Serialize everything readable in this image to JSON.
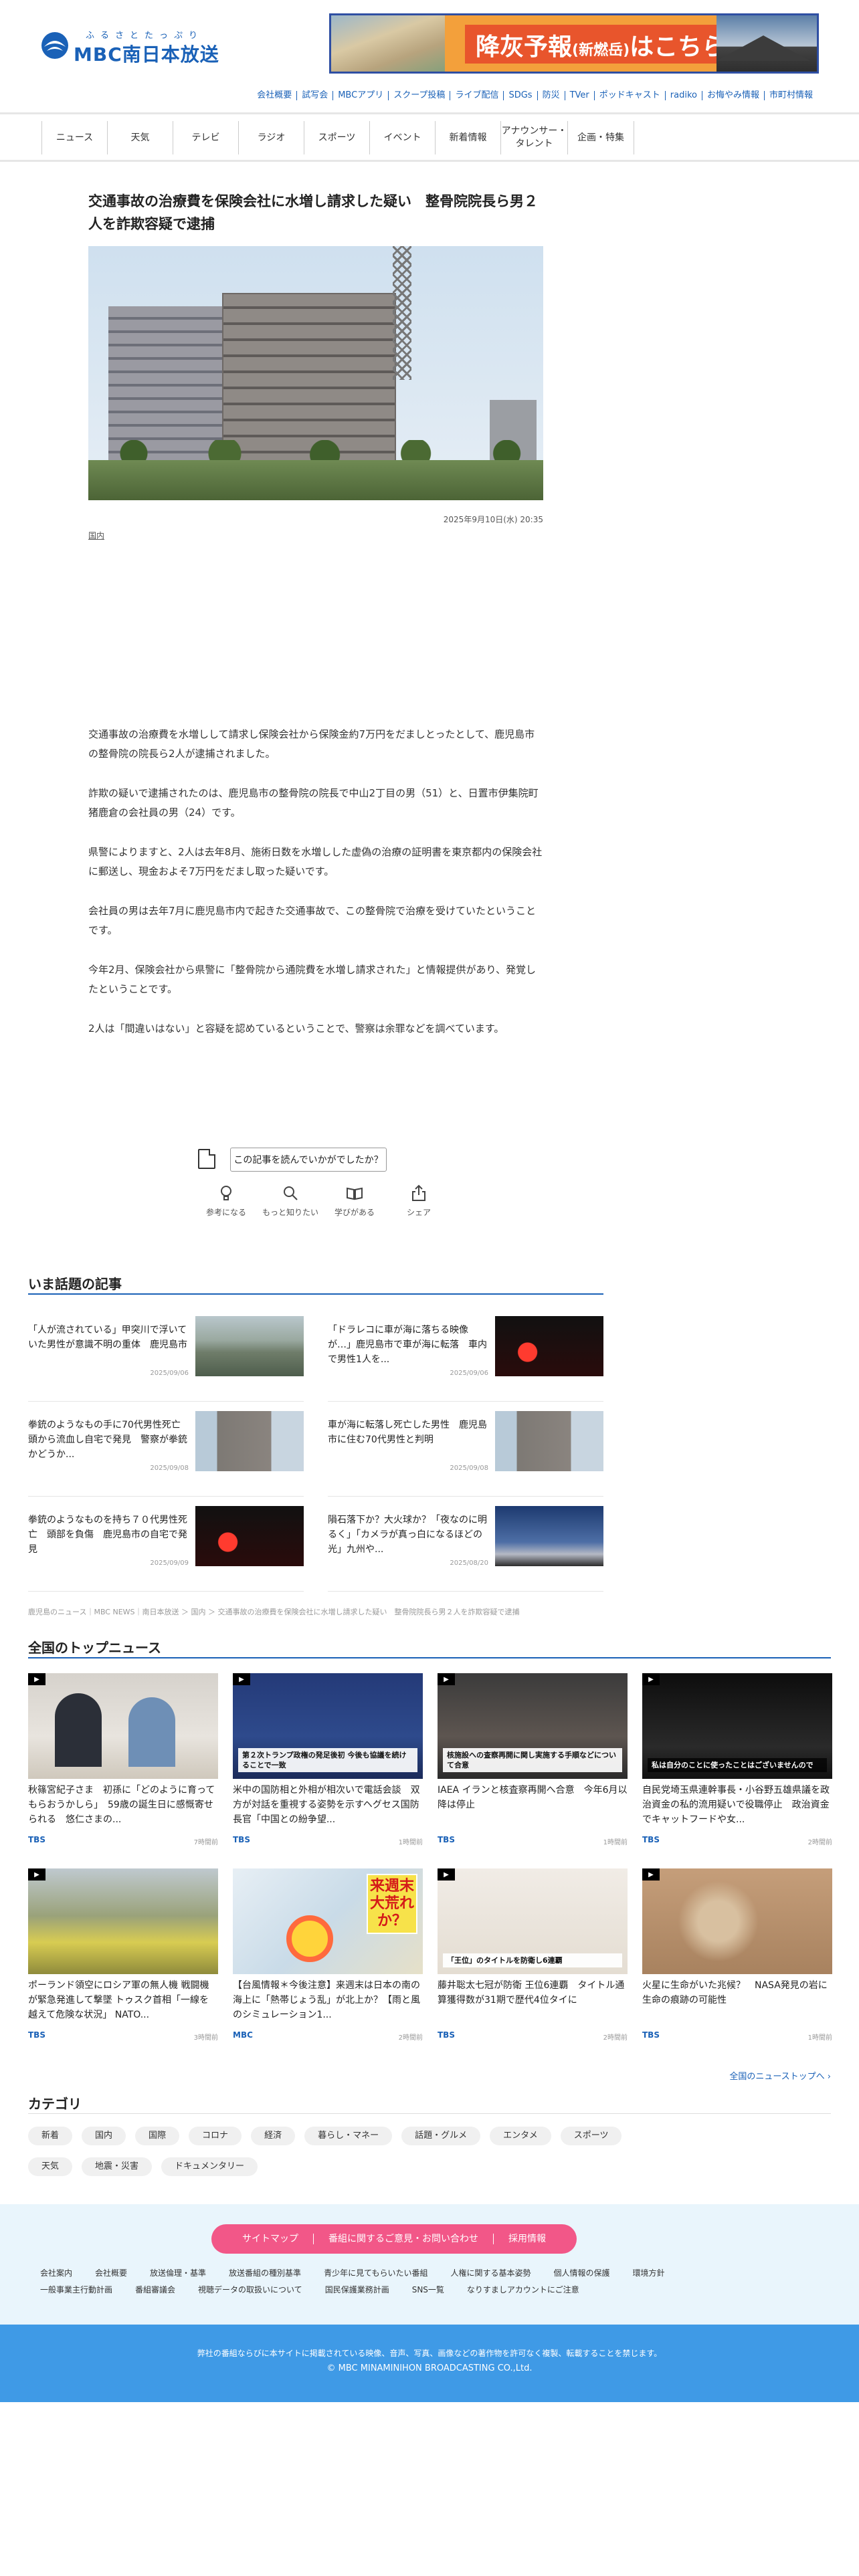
{
  "header": {
    "logo_kana": "ふるさとたっぷり",
    "logo_text": "MBC南日本放送",
    "banner_main": "降灰予報",
    "banner_sub": "(新燃岳)",
    "banner_tail": "はこちら",
    "utility_links": [
      "会社概要",
      "試写会",
      "MBCアプリ",
      "スクープ投稿",
      "ライブ配信",
      "SDGs",
      "防災",
      "TVer",
      "ポッドキャスト",
      "radiko",
      "お悔やみ情報",
      "市町村情報"
    ]
  },
  "nav": {
    "items": [
      "ニュース",
      "天気",
      "テレビ",
      "ラジオ",
      "スポーツ",
      "イベント",
      "新着情報",
      "アナウンサー・タレント",
      "企画・特集"
    ]
  },
  "article": {
    "title": "交通事故の治療費を保険会社に水増し請求した疑い　整骨院院長ら男２人を詐欺容疑で逮捕",
    "date": "2025年9月10日(水) 20:35",
    "category": "国内",
    "paragraphs": [
      "交通事故の治療費を水増しして請求し保険会社から保険金約7万円をだましとったとして、鹿児島市の整骨院の院長ら2人が逮捕されました。",
      "詐欺の疑いで逮捕されたのは、鹿児島市の整骨院の院長で中山2丁目の男（51）と、日置市伊集院町猪鹿倉の会社員の男（24）です。",
      "県警によりますと、2人は去年8月、施術日数を水増しした虚偽の治療の証明書を東京都内の保険会社に郵送し、現金およそ7万円をだまし取った疑いです。",
      "会社員の男は去年7月に鹿児島市内で起きた交通事故で、この整骨院で治療を受けていたということです。",
      "今年2月、保険会社から県警に「整骨院から通院費を水増し請求された」と情報提供があり、発覚したということです。",
      "2人は「間違いはない」と容疑を認めているということで、警察は余罪などを調べています。"
    ]
  },
  "survey": {
    "button": "この記事を読んでいかがでしたか？",
    "reactions": [
      "参考になる",
      "もっと知りたい",
      "学びがある",
      "シェア"
    ]
  },
  "hot": {
    "title": "いま話題の記事",
    "items": [
      {
        "title": "「人が流されている」甲突川で浮いていた男性が意識不明の重体　鹿児島市",
        "date": "2025/09/06"
      },
      {
        "title": "「ドラレコに車が海に落ちる映像が…」鹿児島市で車が海に転落　車内で男性1人を...",
        "date": "2025/09/06"
      },
      {
        "title": "拳銃のようなもの手に70代男性死亡　頭から流血し自宅で発見　警察が拳銃かどうか...",
        "date": "2025/09/08"
      },
      {
        "title": "車が海に転落し死亡した男性　鹿児島市に住む70代男性と判明",
        "date": "2025/09/08"
      },
      {
        "title": "拳銃のようなものを持ち７０代男性死亡　頭部を負傷　鹿児島市の自宅で発見",
        "date": "2025/09/09"
      },
      {
        "title": "隕石落下か？大火球か？「夜なのに明るく」「カメラが真っ白になるほどの光」九州や...",
        "date": "2025/08/20"
      }
    ]
  },
  "breadcrumbs": "鹿児島のニュース｜MBC NEWS｜南日本放送 ＞ 国内 ＞ 交通事故の治療費を保険会社に水増し請求した疑い　整骨院院長ら男２人を詐欺容疑で逮捕",
  "top_news": {
    "title": "全国のトップニュース",
    "items": [
      {
        "title": "秋篠宮紀子さま　初孫に「どのように育ってもらおうかしら」　59歳の誕生日に感慨寄せられる　悠仁さまの...",
        "source": "TBS",
        "time": "7時間前",
        "caption": ""
      },
      {
        "title": "米中の国防相と外相が相次いで電話会談　双方が対話を重視する姿勢を示すヘグセス国防長官「中国との紛争望...",
        "source": "TBS",
        "time": "1時間前",
        "caption": "第２次トランプ政権の発足後初 今後も協議を続けることで一致"
      },
      {
        "title": "IAEA イランと核査察再開へ合意　今年6月以降は停止",
        "source": "TBS",
        "time": "1時間前",
        "caption": "核施設への査察再開に関し実施する手順などについて合意"
      },
      {
        "title": "自民党埼玉県連幹事長・小谷野五雄県議を政治資金の私的流用疑いで役職停止　政治資金でキャットフードや女...",
        "source": "TBS",
        "time": "2時間前",
        "caption": "私は自分のことに使ったことはございませんので"
      },
      {
        "title": "ポーランド領空にロシア軍の無人機 戦闘機が緊急発進して撃墜 トゥスク首相「一線を越えて危険な状況」 NATO...",
        "source": "TBS",
        "time": "3時間前",
        "caption": ""
      },
      {
        "title": "【台風情報＊今後注意】来週末は日本の南の海上に「熱帯じょう乱」が北上か？【雨と風のシミュレーション1...",
        "source": "MBC",
        "time": "2時間前",
        "caption": "来週末 大荒れか？"
      },
      {
        "title": "藤井聡太七冠が防衛 王位6連覇　タイトル通算獲得数が31期で歴代4位タイに",
        "source": "TBS",
        "time": "2時間前",
        "caption": "「王位」のタイトルを防衛し6連覇"
      },
      {
        "title": "火星に生命がいた兆候？　NASA発見の岩に生命の痕跡の可能性",
        "source": "TBS",
        "time": "1時間前",
        "caption": ""
      }
    ],
    "more": "全国のニューストップへ ›"
  },
  "categories": {
    "title": "カテゴリ",
    "items": [
      "新着",
      "国内",
      "国際",
      "コロナ",
      "経済",
      "暮らし・マネー",
      "話題・グルメ",
      "エンタメ",
      "スポーツ",
      "天気",
      "地震・災害",
      "ドキュメンタリー"
    ]
  },
  "footer": {
    "buttons": [
      "サイトマップ",
      "番組に関するご意見・お問い合わせ",
      "採用情報"
    ],
    "links": [
      "会社案内",
      "会社概要",
      "放送倫理・基準",
      "放送番組の種別基準",
      "青少年に見てもらいたい番組",
      "人権に関する基本姿勢",
      "個人情報の保護",
      "環境方針",
      "一般事業主行動計画",
      "番組審議会",
      "視聴データの取扱いについて",
      "国民保護業務計画",
      "SNS一覧",
      "なりすましアカウントにご注意"
    ],
    "copy_note": "弊社の番組ならびに本サイトに掲載されている映像、音声、写真、画像などの著作物を許可なく複製、転載することを禁じます。",
    "copyright": "© MBC MINAMINIHON BROADCASTING CO.,Ltd."
  },
  "colors": {
    "brand": "#1a61b7",
    "footer_pink": "#f25788",
    "copyright_blue": "#3f9ae6"
  }
}
